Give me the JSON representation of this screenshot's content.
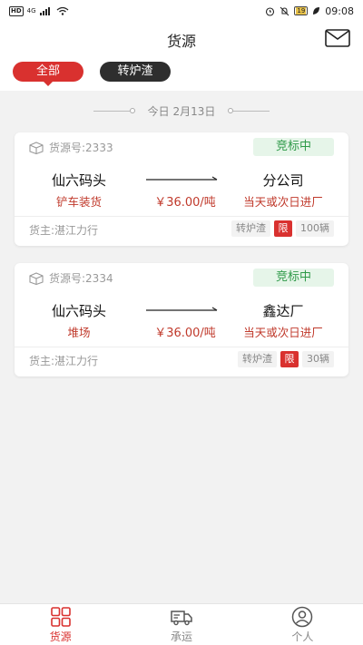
{
  "status_bar": {
    "hd": "HD",
    "network": "4G",
    "battery": "19",
    "time": "09:08"
  },
  "header": {
    "title": "货源"
  },
  "filters": [
    {
      "label": "全部",
      "active": true
    },
    {
      "label": "转炉渣",
      "active": false
    }
  ],
  "date_label": "今日 2月13日",
  "cards": [
    {
      "source_no": "货源号:2333",
      "status": "竞标中",
      "from": "仙六码头",
      "from_sub": "铲车装货",
      "price": "￥36.00/吨",
      "to": "分公司",
      "to_sub": "当天或次日进厂",
      "owner": "货主:湛江力行",
      "material": "转炉渣",
      "limit": "限",
      "count": "100辆"
    },
    {
      "source_no": "货源号:2334",
      "status": "竞标中",
      "from": "仙六码头",
      "from_sub": "堆场",
      "price": "￥36.00/吨",
      "to": "鑫达厂",
      "to_sub": "当天或次日进厂",
      "owner": "货主:湛江力行",
      "material": "转炉渣",
      "limit": "限",
      "count": "30辆"
    }
  ],
  "tabbar": [
    {
      "label": "货源",
      "icon": "grid-icon",
      "active": true
    },
    {
      "label": "承运",
      "icon": "truck-icon",
      "active": false
    },
    {
      "label": "个人",
      "icon": "person-icon",
      "active": false
    }
  ],
  "colors": {
    "accent": "#d9312f",
    "status_green": "#2f9a49",
    "status_bg": "#e6f5e9",
    "price_red": "#c0392b"
  }
}
